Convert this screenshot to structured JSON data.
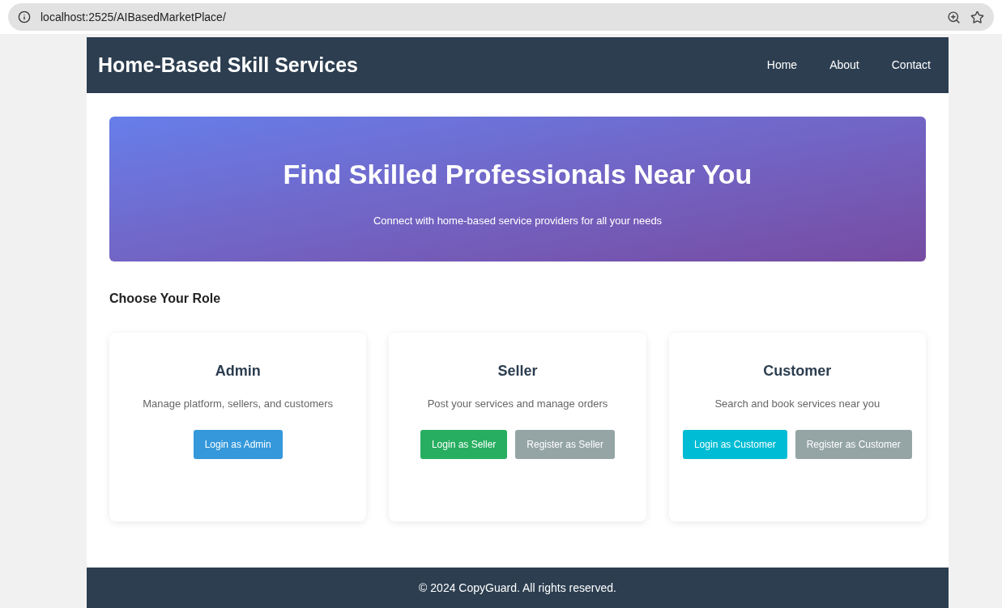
{
  "browser": {
    "url": "localhost:2525/AIBasedMarketPlace/"
  },
  "header": {
    "title": "Home-Based Skill Services",
    "nav": [
      "Home",
      "About",
      "Contact"
    ]
  },
  "hero": {
    "title": "Find Skilled Professionals Near You",
    "subtitle": "Connect with home-based service providers for all your needs"
  },
  "section_title": "Choose Your Role",
  "roles": [
    {
      "title": "Admin",
      "description": "Manage platform, sellers, and customers",
      "buttons": [
        {
          "label": "Login as Admin",
          "color": "#3498db"
        }
      ]
    },
    {
      "title": "Seller",
      "description": "Post your services and manage orders",
      "buttons": [
        {
          "label": "Login as Seller",
          "color": "#27ae60"
        },
        {
          "label": "Register as Seller",
          "color": "#95a5a6"
        }
      ]
    },
    {
      "title": "Customer",
      "description": "Search and book services near you",
      "buttons": [
        {
          "label": "Login as Customer",
          "color": "#00bcd4"
        },
        {
          "label": "Register as Customer",
          "color": "#95a5a6"
        }
      ]
    }
  ],
  "footer": "© 2024 CopyGuard. All rights reserved."
}
